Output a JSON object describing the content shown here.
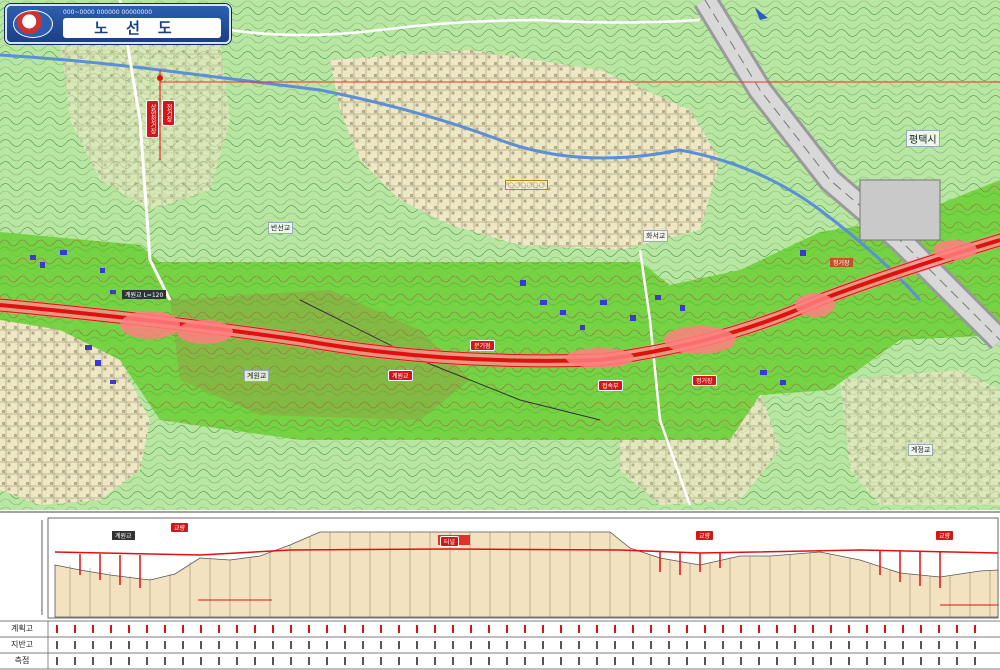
{
  "title": {
    "subtitle": "000~0000 000000 00000000",
    "main": "노선도"
  },
  "map": {
    "place_labels": [
      "반선교",
      "화서교",
      "계원교",
      "평택시",
      "계정교",
      "○○○○○○"
    ],
    "red_tags": [
      "계원교",
      "분기점",
      "접속부",
      "정거장"
    ],
    "dark_tags": [
      "계원교 L=120",
      "정거장"
    ],
    "vertical_station_label": "상현정거장",
    "vertical_station_label2": "정거장"
  },
  "profile": {
    "tags": [
      "계원교",
      "교량",
      "터널",
      "교량",
      "교량"
    ],
    "rows": [
      {
        "label": "계획고"
      },
      {
        "label": "지반고"
      },
      {
        "label": "측점"
      }
    ]
  }
}
